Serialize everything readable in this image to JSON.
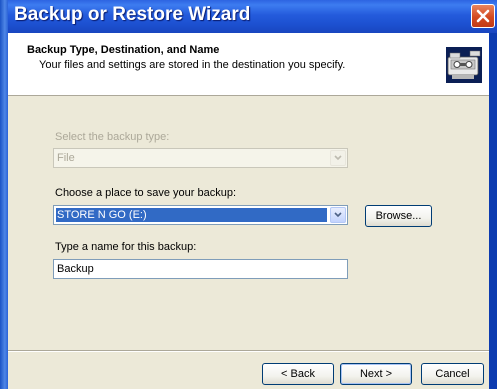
{
  "window": {
    "title": "Backup or Restore Wizard"
  },
  "header": {
    "title": "Backup Type, Destination, and Name",
    "subtitle": "Your files and settings are stored in the destination you specify."
  },
  "form": {
    "backup_type_label": "Select the backup type:",
    "backup_type_value": "File",
    "destination_label": "Choose a place to save your backup:",
    "destination_value": "STORE N GO (E:)",
    "browse_label": "Browse...",
    "name_label": "Type a name for this backup:",
    "name_value": "Backup"
  },
  "footer": {
    "back_label": "< Back",
    "next_label": "Next >",
    "cancel_label": "Cancel"
  },
  "icons": {
    "close": "close-icon",
    "wizard": "backup-tape-icon",
    "dropdown": "chevron-down-icon"
  },
  "colors": {
    "titlebar": "#245bdc",
    "selection": "#316ac5",
    "close_button": "#d34a22",
    "dialog_face": "#ece9d8"
  }
}
